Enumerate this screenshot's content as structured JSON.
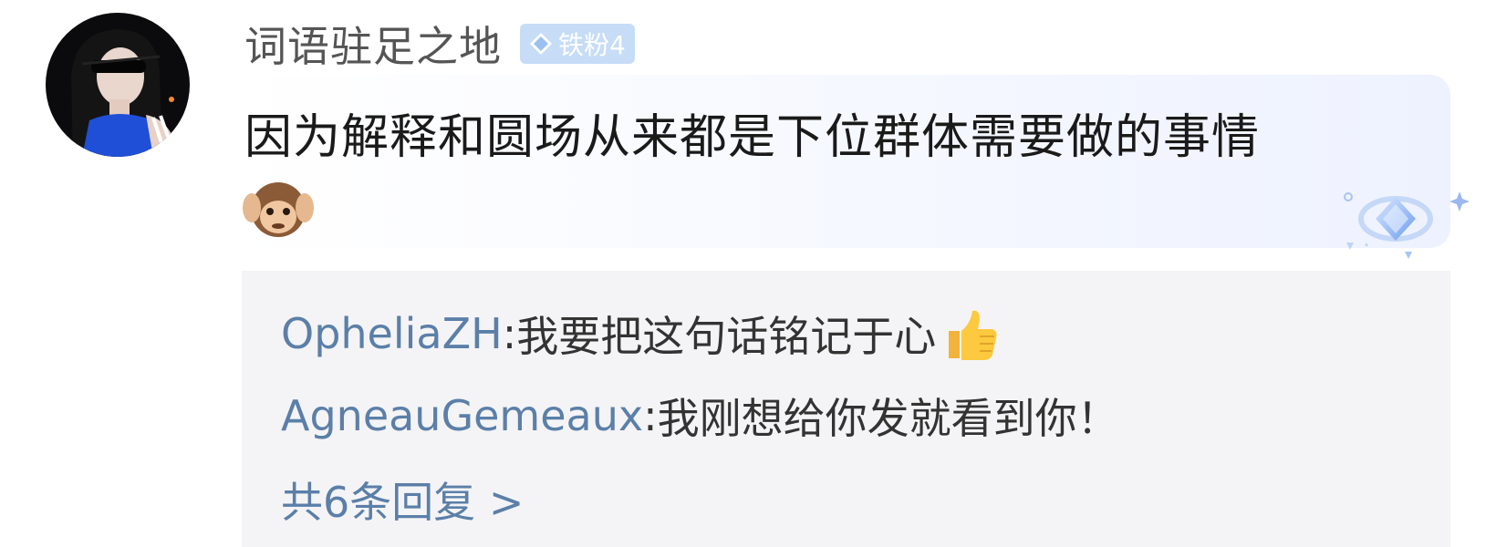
{
  "comment": {
    "username": "词语驻足之地",
    "badge": {
      "icon": "diamond-icon",
      "label": "铁粉4"
    },
    "text": "因为解释和圆场从来都是下位群体需要做的事情",
    "emoji": "see-no-evil-monkey-emoji"
  },
  "replies": [
    {
      "author": "OpheliaZH",
      "separator": ": ",
      "text": "我要把这句话铭记于心",
      "emoji": "thumbs-up-emoji"
    },
    {
      "author": "AgneauGemeaux",
      "separator": ": ",
      "text": "我刚想给你发就看到你！"
    }
  ],
  "more_replies_label": "共6条回复 >",
  "colors": {
    "username": "#555555",
    "badge_bg": "#c6dcf7",
    "reply_author": "#5b7fa8",
    "reply_bg": "#f4f4f6",
    "text": "#1a1a1a"
  }
}
